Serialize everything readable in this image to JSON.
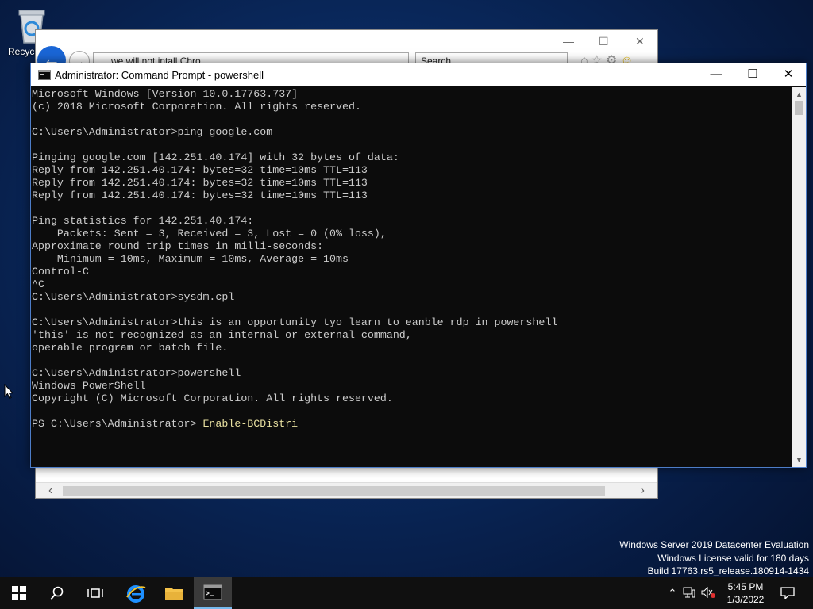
{
  "desktop": {
    "recycle_bin_label": "Recycl",
    "watermark": {
      "line1": "Windows Server 2019 Datacenter Evaluation",
      "line2": "Windows License valid for 180 days",
      "line3": "Build 17763.rs5_release.180914-1434"
    }
  },
  "ie_window": {
    "address_text": "we will not intall Chro",
    "search_placeholder": "Search..."
  },
  "cmd_window": {
    "title": "Administrator: Command Prompt - powershell",
    "lines": [
      "Microsoft Windows [Version 10.0.17763.737]",
      "(c) 2018 Microsoft Corporation. All rights reserved.",
      "",
      "C:\\Users\\Administrator>ping google.com",
      "",
      "Pinging google.com [142.251.40.174] with 32 bytes of data:",
      "Reply from 142.251.40.174: bytes=32 time=10ms TTL=113",
      "Reply from 142.251.40.174: bytes=32 time=10ms TTL=113",
      "Reply from 142.251.40.174: bytes=32 time=10ms TTL=113",
      "",
      "Ping statistics for 142.251.40.174:",
      "    Packets: Sent = 3, Received = 3, Lost = 0 (0% loss),",
      "Approximate round trip times in milli-seconds:",
      "    Minimum = 10ms, Maximum = 10ms, Average = 10ms",
      "Control-C",
      "^C",
      "C:\\Users\\Administrator>sysdm.cpl",
      "",
      "C:\\Users\\Administrator>this is an opportunity tyo learn to eanble rdp in powershell",
      "'this' is not recognized as an internal or external command,",
      "operable program or batch file.",
      "",
      "C:\\Users\\Administrator>powershell",
      "Windows PowerShell",
      "Copyright (C) Microsoft Corporation. All rights reserved.",
      "",
      "PS C:\\Users\\Administrator> "
    ],
    "current_input": "Enable-BCDistri"
  },
  "taskbar": {
    "clock_time": "5:45 PM",
    "clock_date": "1/3/2022"
  },
  "colors": {
    "console_bg": "#0c0c0c",
    "console_text": "#cccccc",
    "console_input": "#e8e0a0",
    "taskbar_bg": "#101010",
    "ie_blue": "#1a66d6"
  }
}
